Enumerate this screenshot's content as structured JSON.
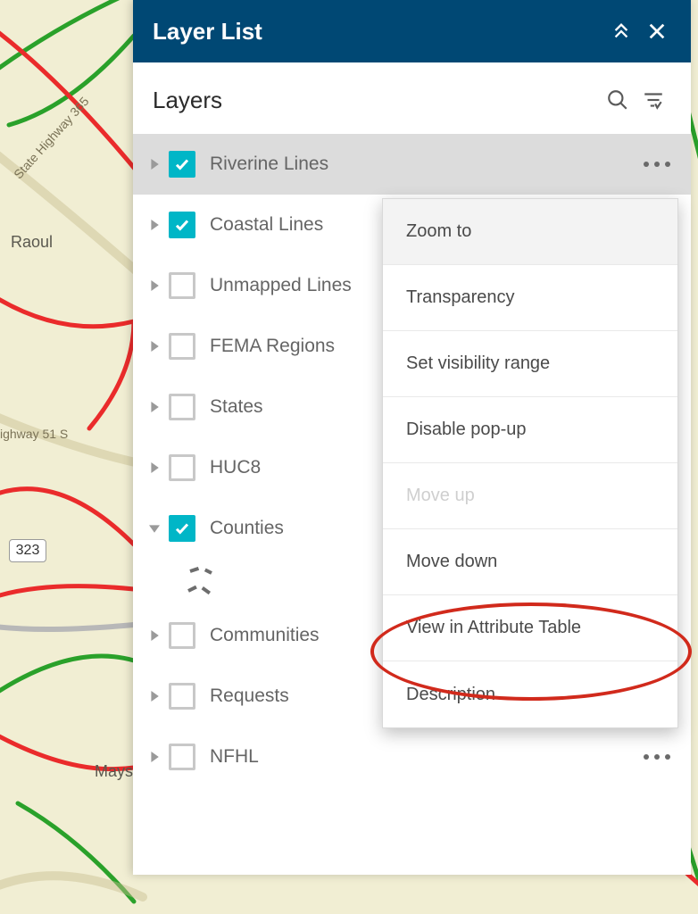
{
  "panel": {
    "title": "Layer List",
    "subtitle": "Layers"
  },
  "layers": [
    {
      "label": "Riverine Lines",
      "checked": true,
      "expanded": false
    },
    {
      "label": "Coastal Lines",
      "checked": true,
      "expanded": false
    },
    {
      "label": "Unmapped Lines",
      "checked": false,
      "expanded": false
    },
    {
      "label": "FEMA Regions",
      "checked": false,
      "expanded": false
    },
    {
      "label": "States",
      "checked": false,
      "expanded": false
    },
    {
      "label": "HUC8",
      "checked": false,
      "expanded": false
    },
    {
      "label": "Counties",
      "checked": true,
      "expanded": true
    },
    {
      "label": "Communities",
      "checked": false,
      "expanded": false
    },
    {
      "label": "Requests",
      "checked": false,
      "expanded": false
    },
    {
      "label": "NFHL",
      "checked": false,
      "expanded": false
    }
  ],
  "context_menu": [
    {
      "label": "Zoom to",
      "highlight": true,
      "disabled": false
    },
    {
      "label": "Transparency",
      "highlight": false,
      "disabled": false
    },
    {
      "label": "Set visibility range",
      "highlight": false,
      "disabled": false
    },
    {
      "label": "Disable pop-up",
      "highlight": false,
      "disabled": false
    },
    {
      "label": "Move up",
      "highlight": false,
      "disabled": true
    },
    {
      "label": "Move down",
      "highlight": false,
      "disabled": false
    },
    {
      "label": "View in Attribute Table",
      "highlight": false,
      "disabled": false
    },
    {
      "label": "Description",
      "highlight": false,
      "disabled": false
    }
  ],
  "map_labels": {
    "road1": "State Highway 365",
    "road2": "ighway 51 S",
    "place1": "Raoul",
    "place2": "Mays",
    "shield1": "323"
  }
}
